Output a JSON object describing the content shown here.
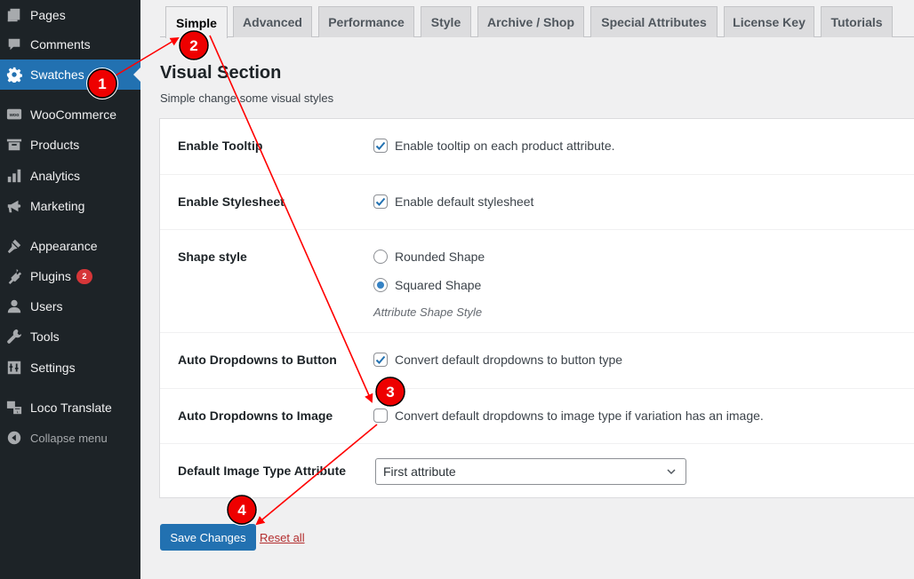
{
  "sidebar": {
    "items": [
      {
        "label": "Pages",
        "icon": "pages-icon"
      },
      {
        "label": "Comments",
        "icon": "comments-icon"
      },
      {
        "label": "Swatches",
        "icon": "gear-icon",
        "active": true
      },
      {
        "label": "WooCommerce",
        "icon": "woocommerce-icon"
      },
      {
        "label": "Products",
        "icon": "products-archive-icon"
      },
      {
        "label": "Analytics",
        "icon": "bar-chart-icon"
      },
      {
        "label": "Marketing",
        "icon": "megaphone-icon"
      },
      {
        "label": "Appearance",
        "icon": "paintbrush-icon"
      },
      {
        "label": "Plugins",
        "icon": "plug-icon",
        "badge": "2"
      },
      {
        "label": "Users",
        "icon": "user-icon"
      },
      {
        "label": "Tools",
        "icon": "wrench-icon"
      },
      {
        "label": "Settings",
        "icon": "sliders-icon"
      },
      {
        "label": "Loco Translate",
        "icon": "translate-icon"
      },
      {
        "label": "Collapse menu",
        "icon": "collapse-arrow-icon"
      }
    ]
  },
  "tabs": [
    {
      "label": "Simple",
      "active": true
    },
    {
      "label": "Advanced"
    },
    {
      "label": "Performance"
    },
    {
      "label": "Style"
    },
    {
      "label": "Archive / Shop"
    },
    {
      "label": "Special Attributes"
    },
    {
      "label": "License Key"
    },
    {
      "label": "Tutorials"
    }
  ],
  "section": {
    "title": "Visual Section",
    "description": "Simple change some visual styles"
  },
  "settings": {
    "tooltip": {
      "label": "Enable Tooltip",
      "text": "Enable tooltip on each product attribute.",
      "checked": true
    },
    "stylesheet": {
      "label": "Enable Stylesheet",
      "text": "Enable default stylesheet",
      "checked": true
    },
    "shape": {
      "label": "Shape style",
      "options": [
        "Rounded Shape",
        "Squared Shape"
      ],
      "selected": "Squared Shape",
      "hint": "Attribute Shape Style"
    },
    "dropdown_button": {
      "label": "Auto Dropdowns to Button",
      "text": "Convert default dropdowns to button type",
      "checked": true
    },
    "dropdown_image": {
      "label": "Auto Dropdowns to Image",
      "text": "Convert default dropdowns to image type if variation has an image.",
      "checked": false
    },
    "image_type_attr": {
      "label": "Default Image Type Attribute",
      "value": "First attribute"
    }
  },
  "actions": {
    "save_label": "Save Changes",
    "reset_label": "Reset all"
  },
  "annotations": {
    "color": "#ff0000",
    "markers": [
      "1",
      "2",
      "3",
      "4"
    ]
  }
}
